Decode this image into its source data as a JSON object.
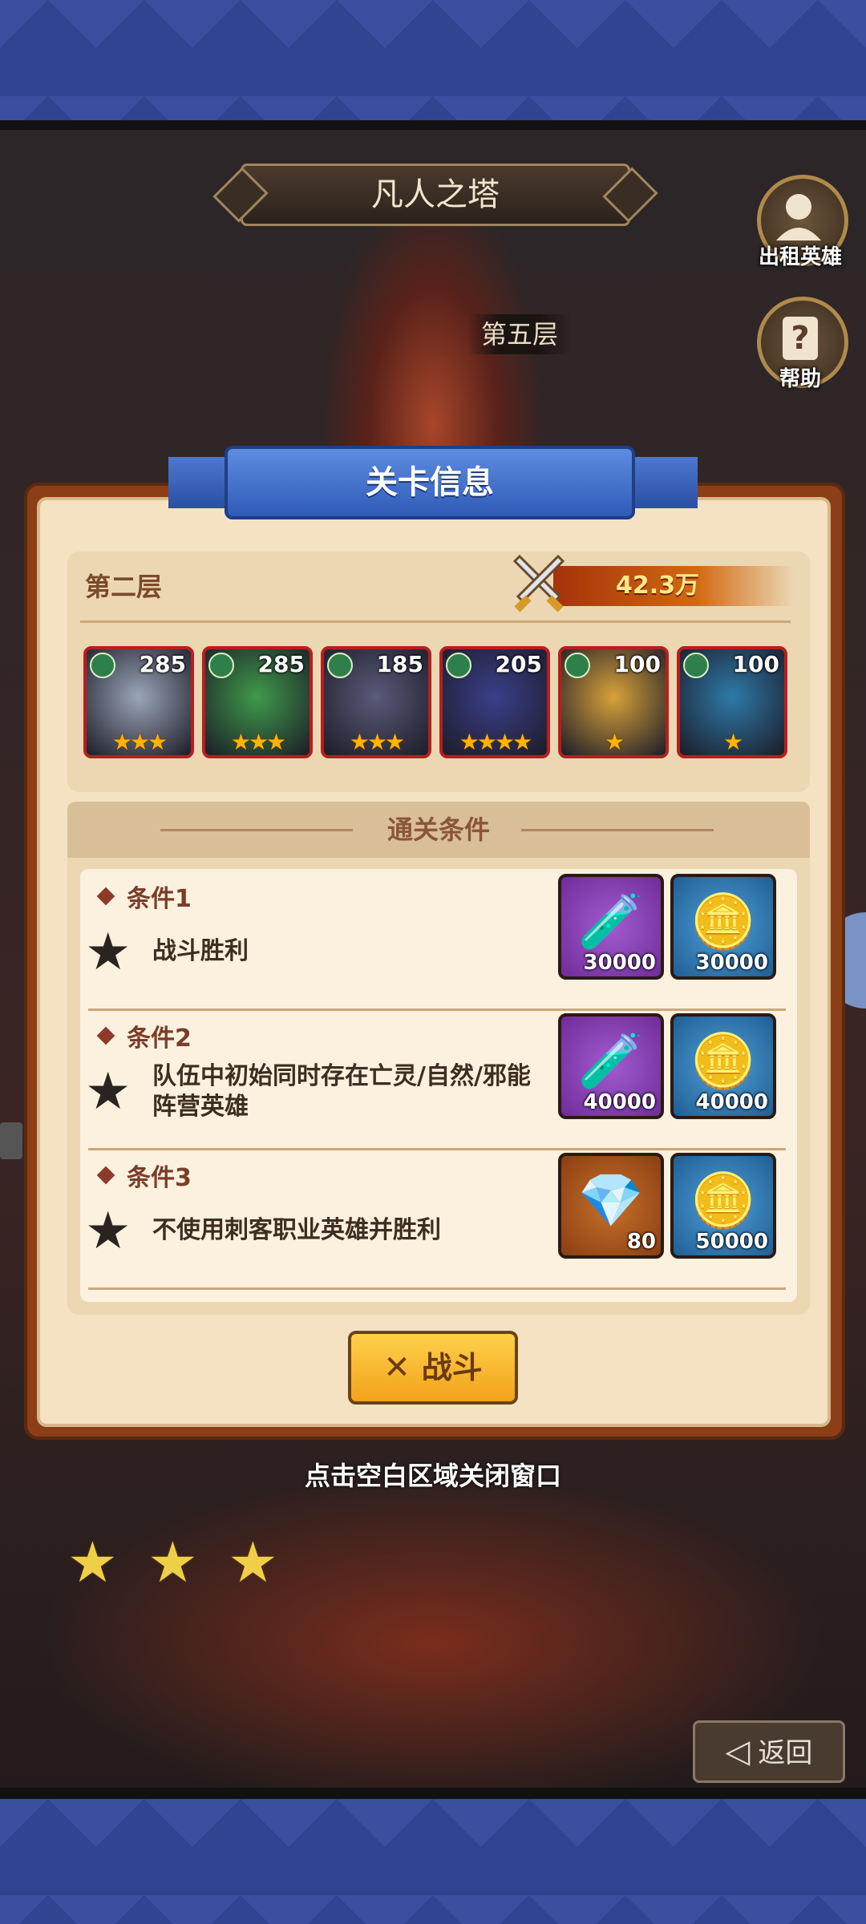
{
  "tower_title": "凡人之塔",
  "current_floor": "第五层",
  "side_buttons": {
    "rent_hero": "出租英雄",
    "help": "帮助"
  },
  "dialog": {
    "title": "关卡信息",
    "enemy_floor": "第二层",
    "power": "42.3万",
    "heroes": [
      {
        "level": "285",
        "stars": "★★★",
        "color": "#9aa6b8"
      },
      {
        "level": "285",
        "stars": "★★★",
        "color": "#3f9a4a"
      },
      {
        "level": "185",
        "stars": "★★★",
        "color": "#5a5a7a"
      },
      {
        "level": "205",
        "stars": "★★★★",
        "color": "#3a3f8a"
      },
      {
        "level": "100",
        "stars": "★",
        "color": "#d8a23a"
      },
      {
        "level": "100",
        "stars": "★",
        "color": "#2d7aa8"
      }
    ],
    "conditions_title": "通关条件",
    "conditions": [
      {
        "name": "条件1",
        "desc": "战斗胜利",
        "rewards": [
          {
            "type": "potion",
            "count": "30000"
          },
          {
            "type": "gold",
            "count": "30000"
          }
        ]
      },
      {
        "name": "条件2",
        "desc": "队伍中初始同时存在亡灵/自然/邪能阵营英雄",
        "rewards": [
          {
            "type": "potion",
            "count": "40000"
          },
          {
            "type": "gold",
            "count": "40000"
          }
        ]
      },
      {
        "name": "条件3",
        "desc": "不使用刺客职业英雄并胜利",
        "rewards": [
          {
            "type": "diamond",
            "count": "80"
          },
          {
            "type": "gold",
            "count": "50000"
          }
        ]
      }
    ],
    "fight_label": "战斗"
  },
  "close_hint": "点击空白区域关闭窗口",
  "back_label": "返回",
  "icons": {
    "fight": "crossed-swords-icon",
    "back": "back-arrow-icon",
    "rent": "person-icon",
    "help": "question-icon"
  }
}
